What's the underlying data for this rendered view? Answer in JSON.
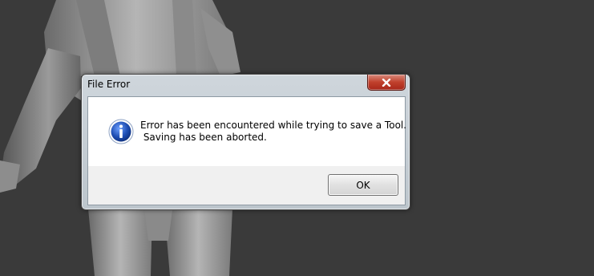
{
  "dialog": {
    "title": "File Error",
    "close_icon": "close-icon",
    "info_icon": "information-icon",
    "message": "Error has been encountered while trying to save a Tool.\n Saving has been aborted.",
    "ok_label": "OK"
  },
  "colors": {
    "background": "#3a3a3a",
    "close_button": "#c0402c",
    "info_icon_blue": "#1f4fb4"
  }
}
